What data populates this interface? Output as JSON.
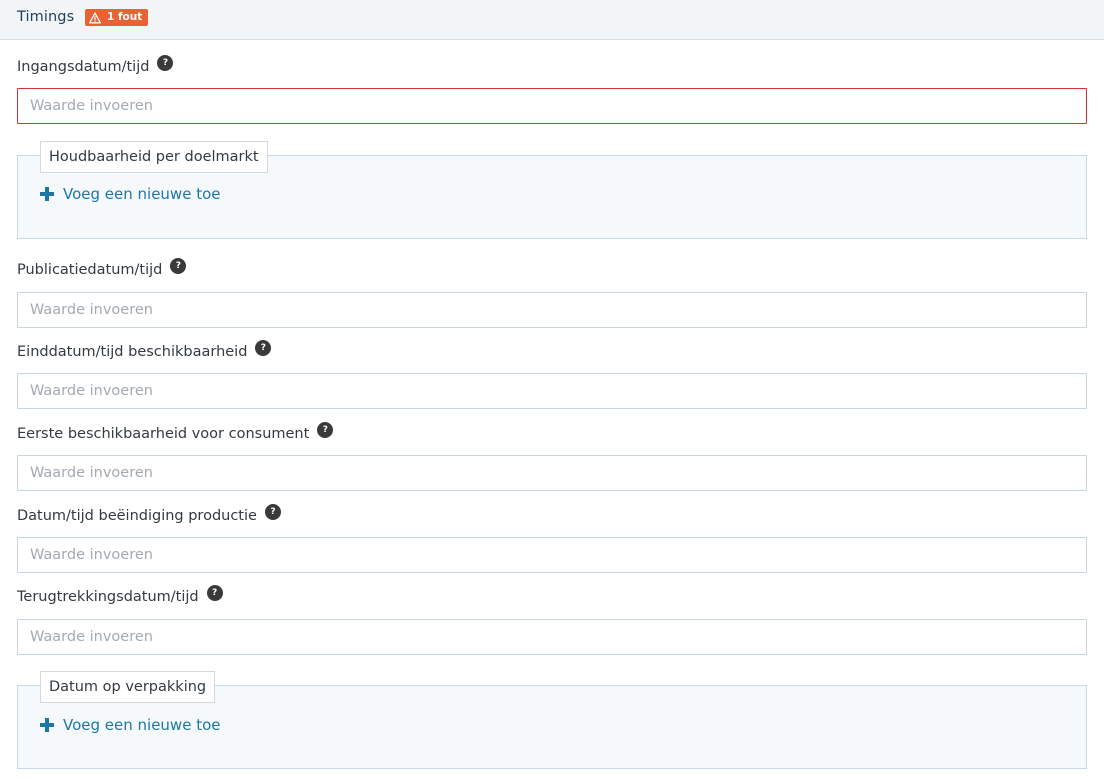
{
  "section": {
    "title": "Timings",
    "error_badge": "1 fout"
  },
  "placeholder": "Waarde invoeren",
  "fields": [
    {
      "label": "Ingangsdatum/tijd",
      "value": "",
      "has_error": true
    },
    {
      "label": "Publicatiedatum/tijd",
      "value": ""
    },
    {
      "label": "Einddatum/tijd beschikbaarheid",
      "value": ""
    },
    {
      "label": "Eerste beschikbaarheid voor consument",
      "value": ""
    },
    {
      "label": "Datum/tijd beëindiging productie",
      "value": ""
    },
    {
      "label": "Terugtrekkingsdatum/tijd",
      "value": ""
    }
  ],
  "groups": [
    {
      "legend": "Houdbaarheid per doelmarkt",
      "add_label": "Voeg een nieuwe toe"
    },
    {
      "legend": "Datum op verpakking",
      "add_label": "Voeg een nieuwe toe"
    }
  ],
  "help_glyph": "?",
  "colors": {
    "header_bg": "#f2f5f8",
    "badge_bg": "#ea6234",
    "error_border": "#d0353a",
    "link": "#1b78a6",
    "group_bg": "#f6f9fc"
  }
}
